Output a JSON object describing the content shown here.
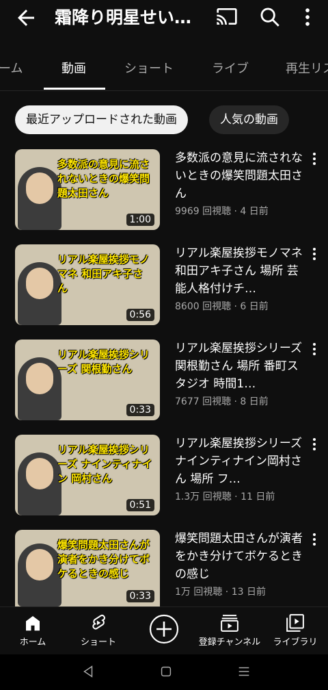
{
  "header": {
    "title": "霜降り明星せい…"
  },
  "tabs": [
    {
      "label": "ーム"
    },
    {
      "label": "動画"
    },
    {
      "label": "ショート"
    },
    {
      "label": "ライブ"
    },
    {
      "label": "再生リス"
    }
  ],
  "chips": [
    {
      "label": "最近アップロードされた動画"
    },
    {
      "label": "人気の動画"
    }
  ],
  "videos": [
    {
      "title": "多数派の意見に流されないときの爆笑問題太田さん",
      "meta": "9969 回視聴 · 4 日前",
      "duration": "1:00",
      "caption": "多数派の意見に流されないときの爆笑問題太田さん"
    },
    {
      "title": "リアル楽屋挨拶モノマネ 和田アキ子さん 場所 芸能人格付けチ…",
      "meta": "8600 回視聴 · 6 日前",
      "duration": "0:56",
      "caption": "リアル楽屋挨拶モノマネ 和田アキ子さん"
    },
    {
      "title": "リアル楽屋挨拶シリーズ 関根勤さん 場所 番町スタジオ 時間1…",
      "meta": "7677 回視聴 · 8 日前",
      "duration": "0:33",
      "caption": "リアル楽屋挨拶シリーズ 関根勤さん"
    },
    {
      "title": "リアル楽屋挨拶シリーズ ナインティナイン岡村さん 場所 フ…",
      "meta": "1.3万 回視聴 · 11 日前",
      "duration": "0:51",
      "caption": "リアル楽屋挨拶シリーズ ナインティナイン 岡村さん"
    },
    {
      "title": "爆笑問題太田さんが演者をかき分けてボケるときの感じ",
      "meta": "1万 回視聴 · 13 日前",
      "duration": "0:33",
      "caption": "爆笑問題太田さんが演者をかき分けてボケるときの感じ"
    }
  ],
  "nav": [
    {
      "label": "ホーム",
      "icon": "home-icon"
    },
    {
      "label": "ショート",
      "icon": "shorts-icon"
    },
    {
      "label": "",
      "icon": "create-icon"
    },
    {
      "label": "登録チャンネル",
      "icon": "subscriptions-icon"
    },
    {
      "label": "ライブラリ",
      "icon": "library-icon"
    }
  ]
}
